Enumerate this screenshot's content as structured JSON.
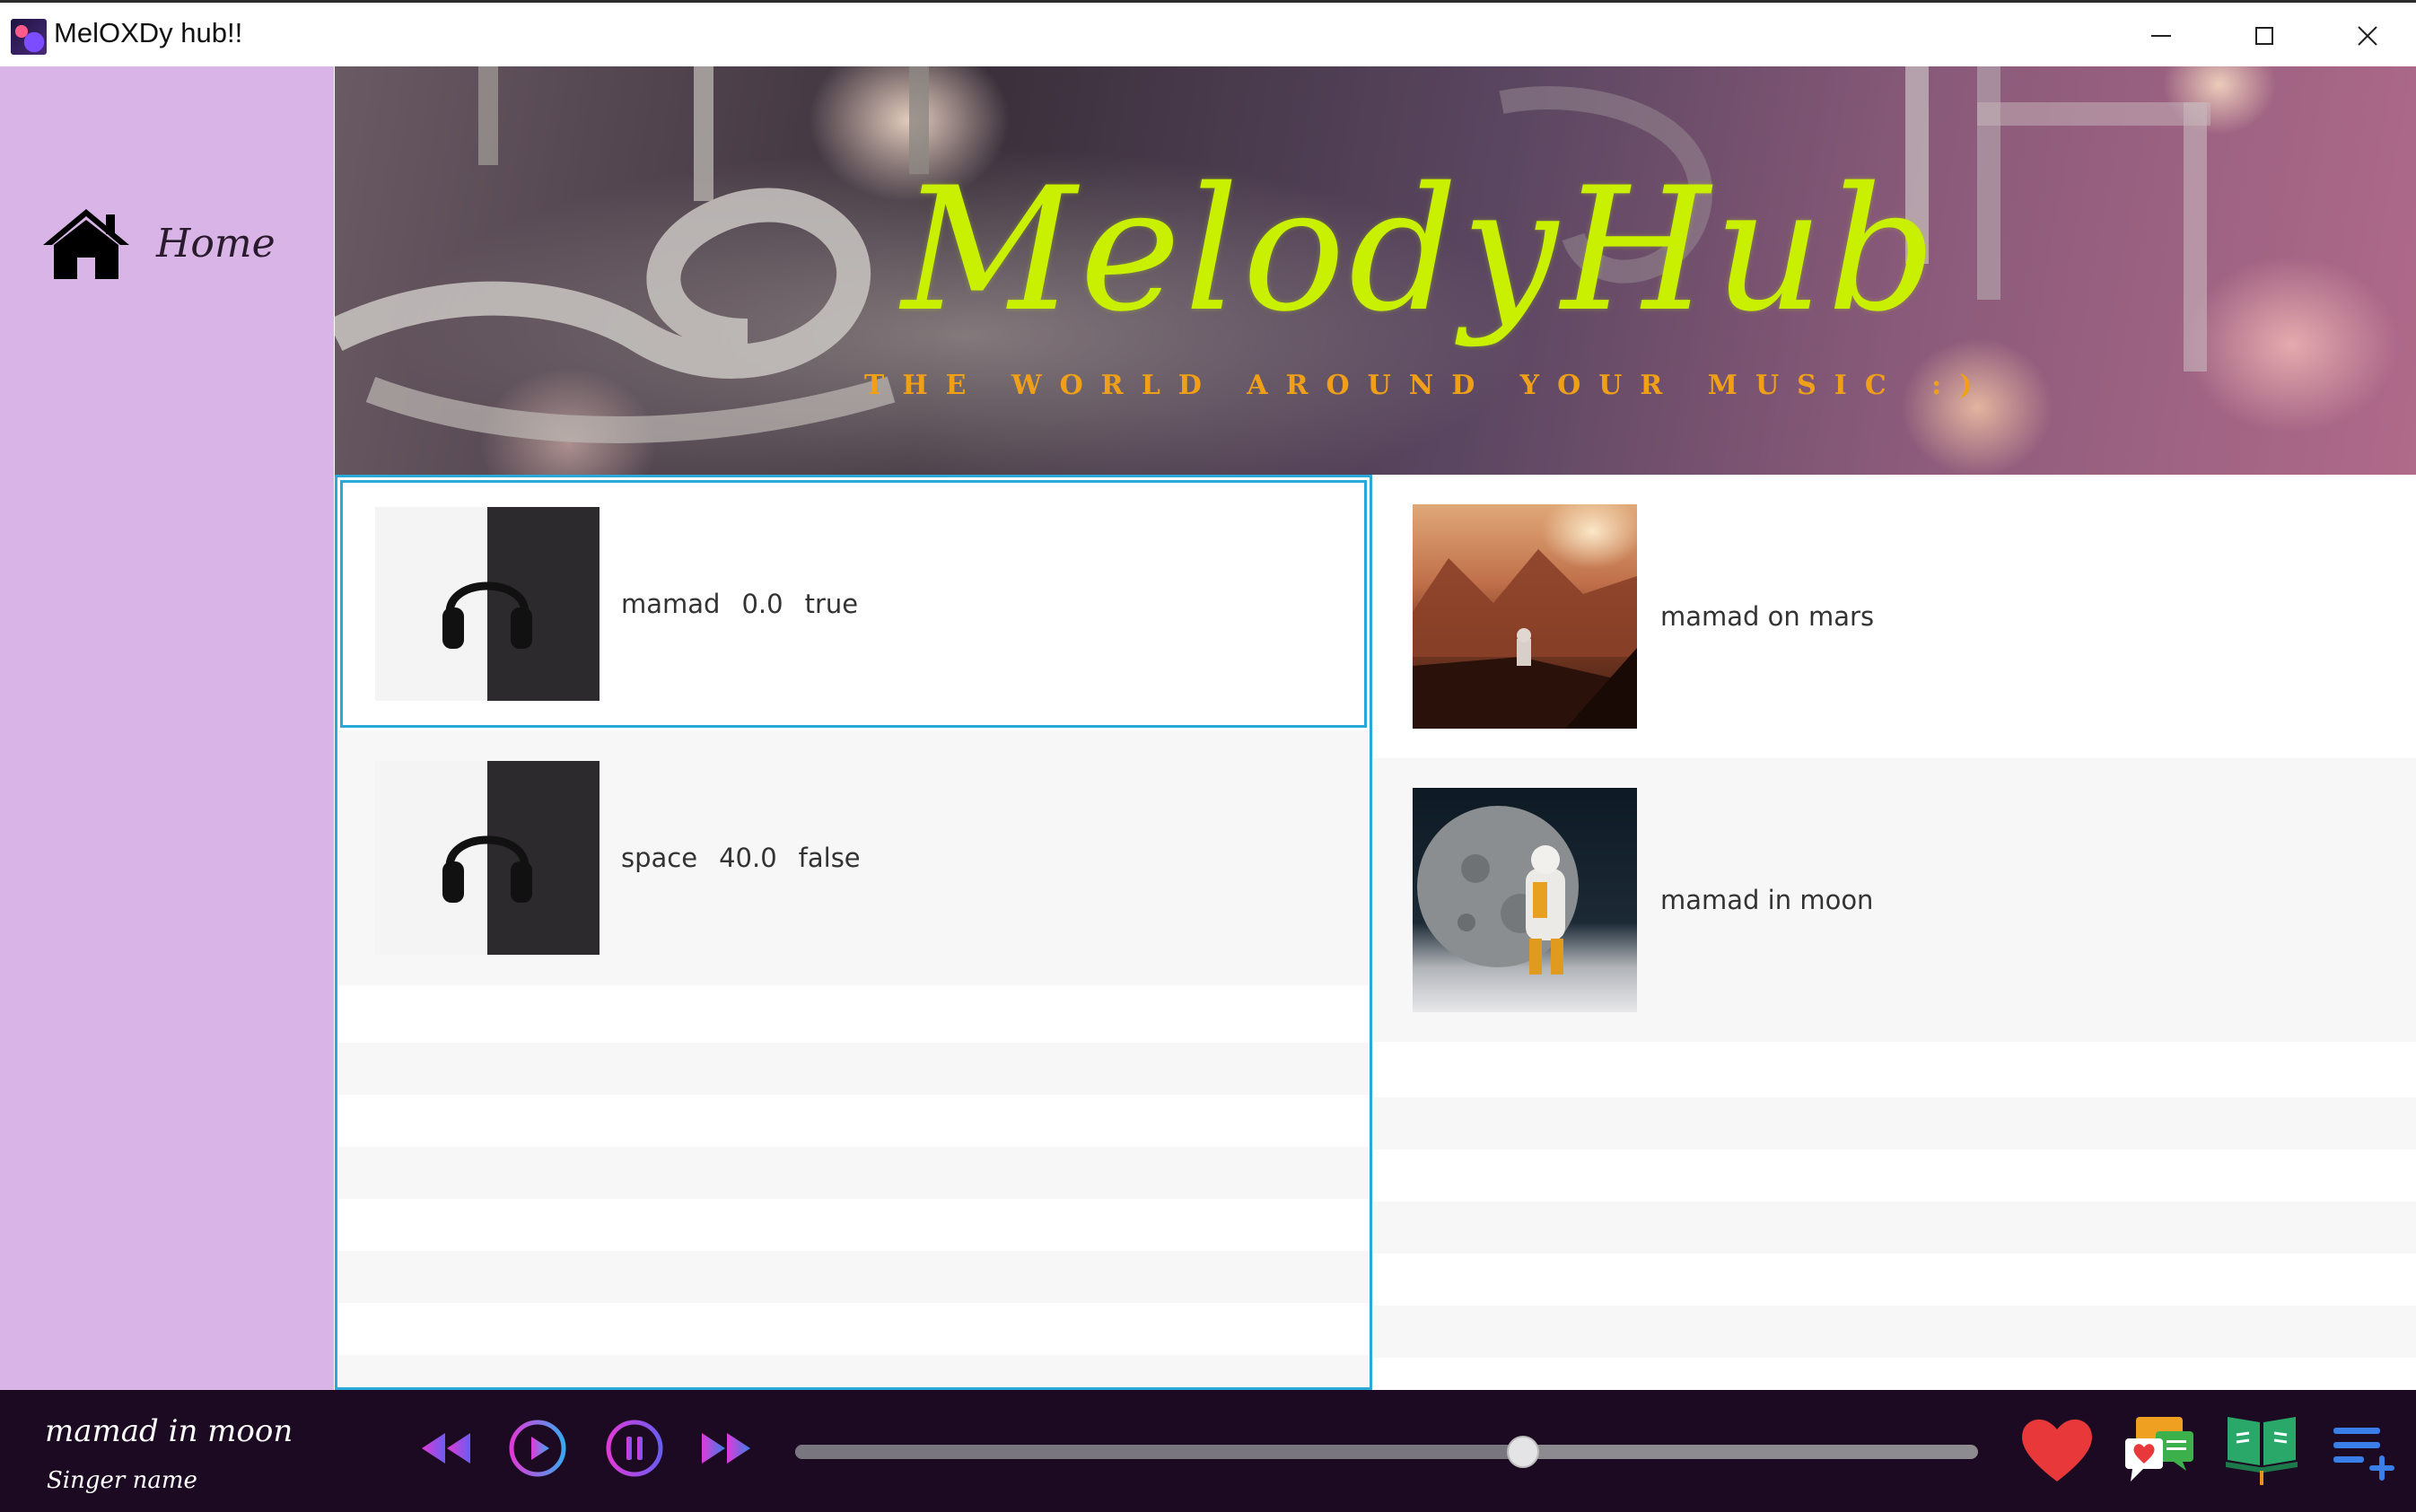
{
  "window": {
    "title": "MelOXDy hub!!",
    "icons": {
      "app": "app-logo-icon",
      "minimize": "minimize-icon",
      "maximize": "maximize-icon",
      "close": "close-icon"
    }
  },
  "sidebar": {
    "items": [
      {
        "label": "Home",
        "icon": "home-icon"
      }
    ]
  },
  "banner": {
    "title": "MelodyHub",
    "tagline": "THE WORLD AROUND YOUR MUSIC :)",
    "colors": {
      "title": "#c8f000",
      "tagline": "#f0a018"
    }
  },
  "left_list": {
    "rows": [
      {
        "name": "mamad",
        "value": "0.0",
        "flag": "true",
        "cover": "headphones-cover",
        "selected": true
      },
      {
        "name": "space",
        "value": "40.0",
        "flag": "false",
        "cover": "headphones-cover",
        "selected": false
      }
    ]
  },
  "right_list": {
    "rows": [
      {
        "title": "mamad on mars",
        "cover": "mars-astronaut-cover"
      },
      {
        "title": "mamad in moon",
        "cover": "moon-astronaut-cover"
      }
    ]
  },
  "player": {
    "song_title": "mamad in moon",
    "singer": "Singer name",
    "progress": 0.615,
    "controls": [
      "rewind-icon",
      "play-icon",
      "pause-icon",
      "fast-forward-icon"
    ],
    "tools": [
      "heart-icon",
      "comments-icon",
      "lyrics-book-icon",
      "add-to-playlist-icon"
    ],
    "colors": {
      "background": "#1c0a22",
      "accent_pink": "#e03ad8",
      "accent_blue": "#3a7ee8",
      "heart": "#e8383a",
      "selection": "#2aa8d8",
      "sidebar": "#d8b5e6"
    }
  }
}
